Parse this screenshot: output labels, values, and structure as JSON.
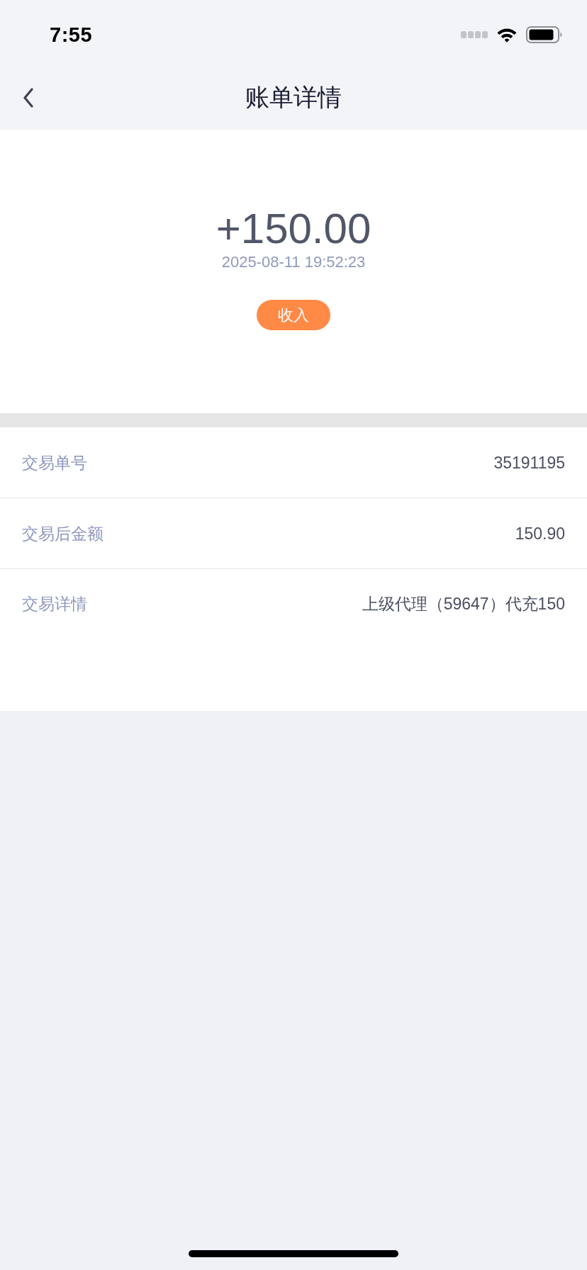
{
  "status_bar": {
    "time": "7:55"
  },
  "nav": {
    "title": "账单详情"
  },
  "summary": {
    "amount": "+150.00",
    "datetime": "2025-08-11 19:52:23",
    "tag": "收入"
  },
  "details": [
    {
      "label": "交易单号",
      "value": "35191195"
    },
    {
      "label": "交易后金额",
      "value": "150.90"
    },
    {
      "label": "交易详情",
      "value": "上级代理（59647）代充150"
    }
  ]
}
